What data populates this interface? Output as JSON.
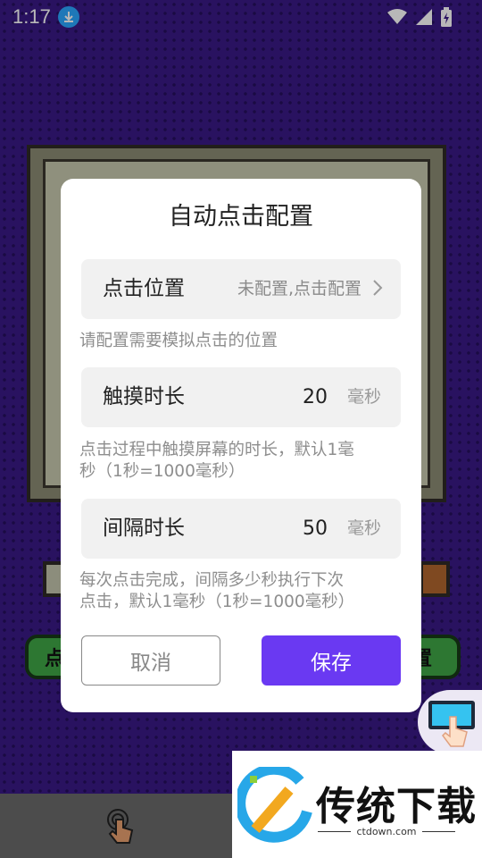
{
  "status_bar": {
    "time": "1:17"
  },
  "background": {
    "left_button_label": "点",
    "right_button_label": "置"
  },
  "dialog": {
    "title": "自动点击配置",
    "position_row": {
      "label": "点击位置",
      "value": "未配置,点击配置"
    },
    "position_hint": "请配置需要模拟点击的位置",
    "touch_row": {
      "label": "触摸时长",
      "value": "20",
      "unit": "毫秒"
    },
    "touch_hint_line1": "点击过程中触摸屏幕的时长，默认1毫",
    "touch_hint_line2": "秒（1秒=1000毫秒）",
    "interval_row": {
      "label": "间隔时长",
      "value": "50",
      "unit": "毫秒"
    },
    "interval_hint_line1": "每次点击完成，间隔多少秒执行下次",
    "interval_hint_line2": "点击，默认1毫秒（1秒=1000毫秒）",
    "cancel_label": "取消",
    "save_label": "保存"
  },
  "watermark": {
    "brand": "传统下载",
    "url": "ctdown.com"
  },
  "colors": {
    "accent": "#6a39f2",
    "background": "#3a1a86",
    "row_bg": "#f1f1f1"
  },
  "icons": [
    "download-icon",
    "wifi-icon",
    "signal-icon",
    "battery-icon",
    "chevron-right-icon",
    "touch-hand-icon",
    "floating-tap-icon"
  ]
}
